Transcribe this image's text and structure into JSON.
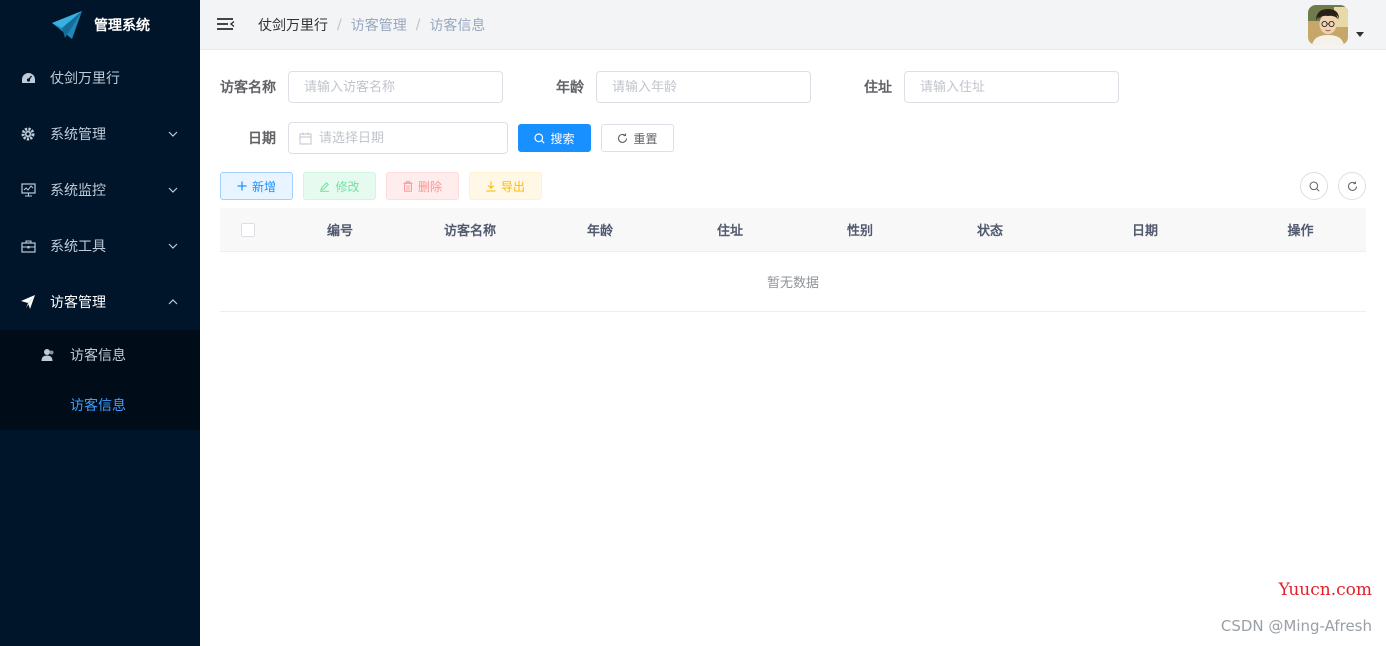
{
  "sidebar": {
    "logo_text": "管理系统",
    "items": [
      {
        "label": "仗剑万里行",
        "icon": "dashboard-icon"
      },
      {
        "label": "系统管理",
        "icon": "gear-icon"
      },
      {
        "label": "系统监控",
        "icon": "monitor-icon"
      },
      {
        "label": "系统工具",
        "icon": "toolbox-icon"
      },
      {
        "label": "访客管理",
        "icon": "send-icon"
      }
    ],
    "sub_items": [
      {
        "label": "访客信息",
        "icon": "user-icon"
      },
      {
        "label": "访客信息"
      }
    ]
  },
  "breadcrumb": [
    "仗剑万里行",
    "访客管理",
    "访客信息"
  ],
  "search": {
    "name_label": "访客名称",
    "name_placeholder": "请输入访客名称",
    "age_label": "年龄",
    "age_placeholder": "请输入年龄",
    "address_label": "住址",
    "address_placeholder": "请输入住址",
    "date_label": "日期",
    "date_placeholder": "请选择日期",
    "search_button": "搜索",
    "reset_button": "重置"
  },
  "toolbar": {
    "add": "新增",
    "edit": "修改",
    "delete": "删除",
    "export": "导出"
  },
  "table": {
    "columns": [
      "编号",
      "访客名称",
      "年龄",
      "住址",
      "性别",
      "状态",
      "日期",
      "操作"
    ],
    "empty_text": "暂无数据"
  },
  "watermarks": {
    "site": "Yuucn.com",
    "author": "CSDN @Ming-Afresh"
  },
  "colors": {
    "sidebar_bg": "#001529",
    "primary": "#1890ff",
    "active_menu": "#409eff"
  }
}
